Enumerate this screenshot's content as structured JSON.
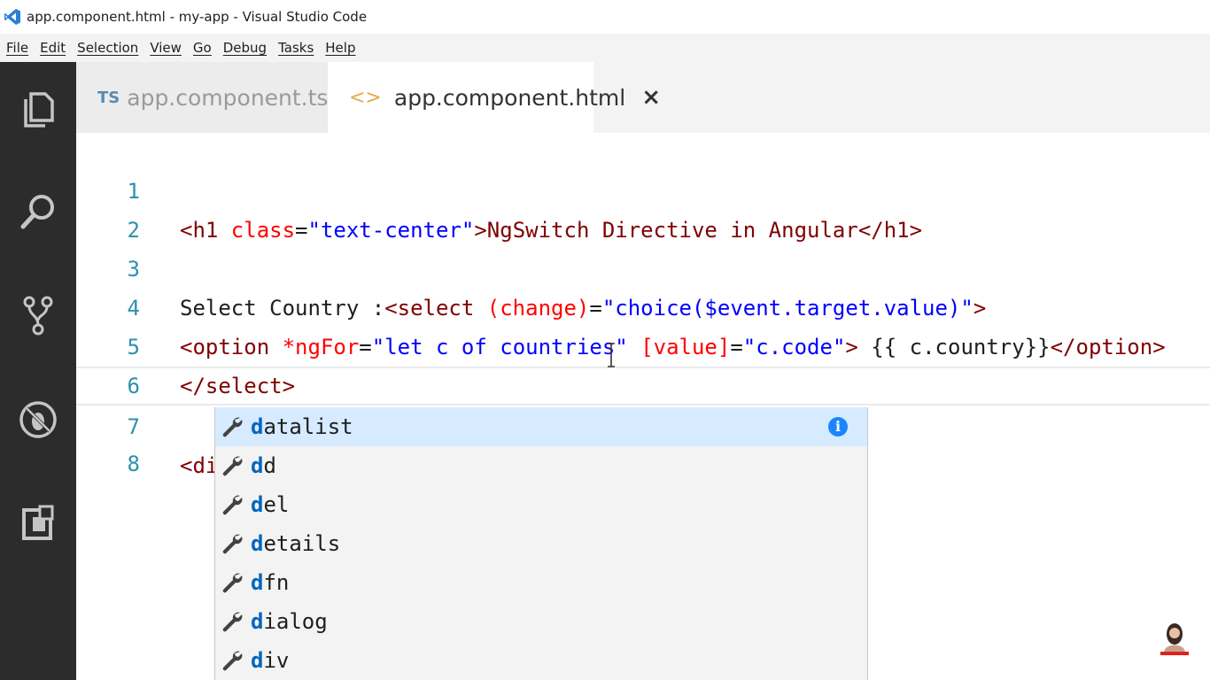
{
  "window": {
    "title": "app.component.html - my-app - Visual Studio Code"
  },
  "menu": [
    "File",
    "Edit",
    "Selection",
    "View",
    "Go",
    "Debug",
    "Tasks",
    "Help"
  ],
  "activity_icons": [
    "explorer-icon",
    "search-icon",
    "source-control-icon",
    "debug-icon",
    "extensions-icon"
  ],
  "tabs": [
    {
      "badge": "TS",
      "label": "app.component.ts",
      "active": false
    },
    {
      "badge": "<>",
      "label": "app.component.html",
      "active": true,
      "close": "×"
    }
  ],
  "editor": {
    "lines": [
      {
        "num": "1",
        "parts": [
          "<h1 ",
          "class",
          "=",
          "\"text-center\"",
          ">NgSwitch Directive in Angular</h1>"
        ]
      },
      {
        "num": "2",
        "parts": []
      },
      {
        "num": "3",
        "parts": [
          "Select Country :",
          "<select ",
          "(change)",
          "=",
          "\"choice($event.target.value)\"",
          ">"
        ]
      },
      {
        "num": "4",
        "parts": [
          "<option ",
          "*ngFor",
          "=",
          "\"let c of countries\"",
          " ",
          "[value]",
          "=",
          "\"c.code\"",
          ">",
          " {{ c.country}}",
          "</option>"
        ]
      },
      {
        "num": "5",
        "parts": [
          "</select>"
        ]
      },
      {
        "num": "6",
        "parts": []
      },
      {
        "num": "7",
        "parts": [
          "<di"
        ]
      },
      {
        "num": "8",
        "parts": []
      }
    ]
  },
  "suggestions": {
    "typed": "d",
    "items": [
      {
        "match": "d",
        "rest": "atalist",
        "selected": true
      },
      {
        "match": "d",
        "rest": "d",
        "selected": false
      },
      {
        "match": "d",
        "rest": "el",
        "selected": false
      },
      {
        "match": "d",
        "rest": "etails",
        "selected": false
      },
      {
        "match": "d",
        "rest": "fn",
        "selected": false
      },
      {
        "match": "d",
        "rest": "ialog",
        "selected": false
      },
      {
        "match": "d",
        "rest": "iv",
        "selected": false
      }
    ],
    "info_glyph": "i"
  },
  "colors": {
    "tag": "#800000",
    "attribute": "#ff0000",
    "string": "#0000ff",
    "line_number": "#2b91af",
    "suggest_highlight": "#0066bf",
    "activity_bar": "#2c2c2c"
  }
}
